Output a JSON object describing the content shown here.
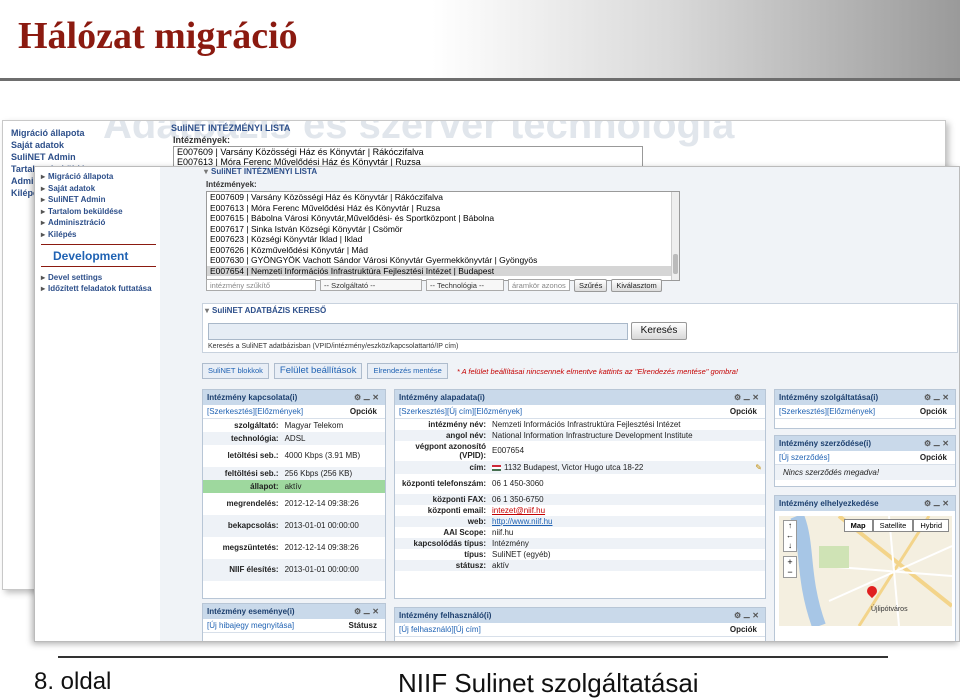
{
  "slide": {
    "title": "Hálózat migráció",
    "page": "8. oldal",
    "footer": "NIIF Sulinet szolgáltatásai",
    "ghost_heading": "Adatbázis és szerver technológia"
  },
  "back_shot": {
    "nav": [
      "Migráció állapota",
      "Saját adatok",
      "SuliNET Admin",
      "Tartalom beküldése",
      "Adminisztráció",
      "Kilépés"
    ],
    "list_title": "SuliNET INTÉZMÉNYI LISTA",
    "list_label": "Intézmények:",
    "items": [
      "E007609 | Varsány Közösségi Ház és Könyvtár | Rákóczifalva",
      "E007613 | Móra Ferenc Művelődési Ház és Könyvtár | Ruzsa"
    ]
  },
  "sidebar": {
    "nav": [
      "Migráció állapota",
      "Saját adatok",
      "SuliNET Admin",
      "Tartalom beküldése",
      "Adminisztráció",
      "Kilépés"
    ],
    "dev_title": "Development",
    "dev_items": [
      "Devel settings",
      "Időzített feladatok futtatása"
    ]
  },
  "institution_list": {
    "title": "SuliNET INTÉZMÉNYI LISTA",
    "label": "Intézmények:",
    "items": [
      "E007609 | Varsány Közösségi Ház és Könyvtár | Rákóczifalva",
      "E007613 | Móra Ferenc Művelődési Ház és Könyvtár | Ruzsa",
      "E007615 | Bábolna Városi Könyvtár,Művelődési- és Sportközpont | Bábolna",
      "E007617 | Sinka István Községi Könyvtár | Csömör",
      "E007623 | Községi Könyvtár Iklad | Iklad",
      "E007626 | Közművelődési Könyvtár | Mád",
      "E007630 | GYÖNGYÖK Vachott Sándor Városi Könyvtár Gyermekkönyvtár | Gyöngyös",
      "E007654 | Nemzeti Információs Infrastruktúra Fejlesztési Intézet | Budapest"
    ],
    "selected_index": 7,
    "filter_placeholder": "intézmény szűkítő",
    "select_service": "-- Szolgáltató --",
    "select_tech": "-- Technológia --",
    "circuit_placeholder": "áramkör azonos",
    "filter_btn": "Szűrés",
    "clear_btn": "Kiválasztom"
  },
  "search": {
    "title": "SuliNET ADATBÁZIS KERESŐ",
    "button": "Keresés",
    "hint": "Keresés a SuliNET adatbázisban (VPID/intézmény/eszköz/kapcsolattartó/IP cím)"
  },
  "toolbar": {
    "blocks_btn": "SuliNET blokkok",
    "layout_btn": "Felület beállítások",
    "save_btn": "Elrendezés mentése",
    "note": "* A felület beállításai nincsennek elmentve kattints az \"Elrendezés mentése\" gombra!"
  },
  "connection_panel": {
    "title": "Intézmény kapcsolata(i)",
    "links": [
      "[Szerkesztés]",
      "[Előzmények]"
    ],
    "options": "Opciók",
    "rows": [
      {
        "k": "szolgáltató:",
        "v": "Magyar Telekom"
      },
      {
        "k": "technológia:",
        "v": "ADSL"
      },
      {
        "k": "letöltési seb.:",
        "v": "4000 Kbps (3.91 MB)"
      },
      {
        "k": "feltöltési seb.:",
        "v": "256 Kbps (256 KB)"
      },
      {
        "k": "állapot:",
        "v": "aktív"
      },
      {
        "k": "megrendelés:",
        "v": "2012-12-14 09:38:26"
      },
      {
        "k": "bekapcsolás:",
        "v": "2013-01-01 00:00:00"
      },
      {
        "k": "megszüntetés:",
        "v": "2012-12-14 09:38:26"
      },
      {
        "k": "NIIF élesítés:",
        "v": "2013-01-01 00:00:00"
      }
    ]
  },
  "basic_panel": {
    "title": "Intézmény alapadata(i)",
    "links": [
      "[Szerkesztés]",
      "[Új cím]",
      "[Előzmények]"
    ],
    "options": "Opciók",
    "rows": [
      {
        "k": "intézmény név:",
        "v": "Nemzeti Információs Infrastruktúra Fejlesztési Intézet"
      },
      {
        "k": "angol név:",
        "v": "National Information Infrastructure Development Institute"
      },
      {
        "k": "végpont azonosító (VPID):",
        "v": "E007654"
      },
      {
        "k": "cím:",
        "v": "1132 Budapest, Victor Hugo utca 18-22"
      },
      {
        "k": "központi telefonszám:",
        "v": "06 1 450-3060"
      },
      {
        "k": "központi FAX:",
        "v": "06 1 350-6750"
      },
      {
        "k": "központi email:",
        "v": "intezet@niif.hu"
      },
      {
        "k": "web:",
        "v": "http://www.niif.hu"
      },
      {
        "k": "AAI Scope:",
        "v": "niif.hu"
      },
      {
        "k": "kapcsolódás típus:",
        "v": "Intézmény"
      },
      {
        "k": "típus:",
        "v": "SuliNET (egyéb)"
      },
      {
        "k": "státusz:",
        "v": "aktív"
      }
    ]
  },
  "contact_panel": {
    "title": "Intézmény szolgáltatása(i)",
    "links": [
      "[Szerkesztés]",
      "[Előzmények]"
    ],
    "options": "Opciók"
  },
  "contract_panel": {
    "title": "Intézmény szerződése(i)",
    "links": [
      "[Új szerződés]"
    ],
    "options": "Opciók",
    "empty": "Nincs szerződés megadva!"
  },
  "location_panel": {
    "title": "Intézmény elhelyezkedése",
    "map_btns": [
      "Map",
      "Satellite",
      "Hybrid"
    ],
    "place": "Újlipótváros"
  },
  "events_panel": {
    "title": "Intézmény eseménye(i)",
    "links": [
      "[Új hibajegy megnyitása]"
    ],
    "status": "Státusz"
  },
  "users_panel": {
    "title": "Intézmény felhasználó(i)",
    "links": [
      "[Új felhasználó]",
      "[Új cím]"
    ],
    "options": "Opciók"
  },
  "colors": {
    "title_red": "#8b1a10",
    "link_blue": "#1f62b3",
    "panel_head": "#c9d9ea",
    "active_green": "#9ed89e"
  }
}
